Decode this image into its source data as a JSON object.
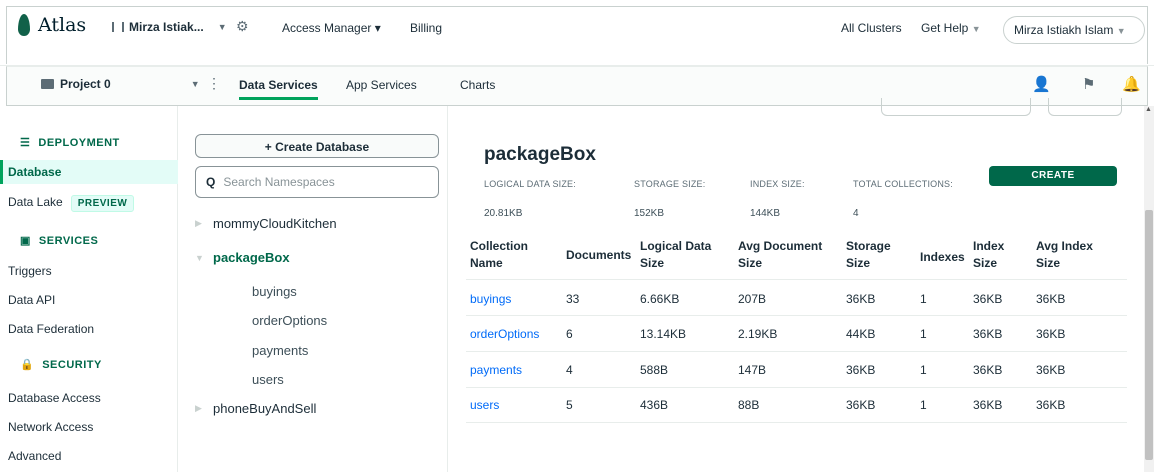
{
  "topbar": {
    "brand": "Atlas",
    "org_name": "Mirza Istiak...",
    "access_manager": "Access Manager ▾",
    "billing": "Billing",
    "all_clusters": "All Clusters",
    "get_help": "Get Help",
    "user": "Mirza Istiakh Islam"
  },
  "subbar": {
    "project": "Project 0",
    "tabs": [
      {
        "label": "Data Services",
        "active": true
      },
      {
        "label": "App Services",
        "active": false
      },
      {
        "label": "Charts",
        "active": false
      }
    ]
  },
  "sidebar": {
    "deployment": "DEPLOYMENT",
    "database": "Database",
    "data_lake": "Data Lake",
    "preview": "PREVIEW",
    "services": "SERVICES",
    "triggers": "Triggers",
    "data_api": "Data API",
    "data_federation": "Data Federation",
    "security": "SECURITY",
    "database_access": "Database Access",
    "network_access": "Network Access",
    "advanced": "Advanced"
  },
  "namespaces": {
    "create_database": "+ Create Database",
    "search_placeholder": "Search Namespaces",
    "databases": [
      "mommyCloudKitchen",
      "packageBox",
      "phoneBuyAndSell"
    ],
    "collections": [
      "buyings",
      "orderOptions",
      "payments",
      "users"
    ]
  },
  "main": {
    "db_name": "packageBox",
    "stats": [
      {
        "label": "LOGICAL DATA SIZE:",
        "value": "20.81KB"
      },
      {
        "label": "STORAGE SIZE:",
        "value": "152KB"
      },
      {
        "label": "INDEX SIZE:",
        "value": "144KB"
      },
      {
        "label": "TOTAL COLLECTIONS:",
        "value": "4"
      }
    ],
    "create_button": "CREATE",
    "columns": [
      {
        "l1": "Collection",
        "l2": "Name"
      },
      {
        "l1": "Documents",
        "l2": ""
      },
      {
        "l1": "Logical Data",
        "l2": "Size"
      },
      {
        "l1": "Avg Document",
        "l2": "Size"
      },
      {
        "l1": "Storage",
        "l2": "Size"
      },
      {
        "l1": "Indexes",
        "l2": ""
      },
      {
        "l1": "Index",
        "l2": "Size"
      },
      {
        "l1": "Avg Index",
        "l2": "Size"
      }
    ],
    "rows": [
      [
        "buyings",
        "33",
        "6.66KB",
        "207B",
        "36KB",
        "1",
        "36KB",
        "36KB"
      ],
      [
        "orderOptions",
        "6",
        "13.14KB",
        "2.19KB",
        "44KB",
        "1",
        "36KB",
        "36KB"
      ],
      [
        "payments",
        "4",
        "588B",
        "147B",
        "36KB",
        "1",
        "36KB",
        "36KB"
      ],
      [
        "users",
        "5",
        "436B",
        "88B",
        "36KB",
        "1",
        "36KB",
        "36KB"
      ]
    ]
  },
  "colors": {
    "brand_green": "#00684a",
    "link_blue": "#016bf8",
    "active_bg": "#e3fcf7"
  }
}
